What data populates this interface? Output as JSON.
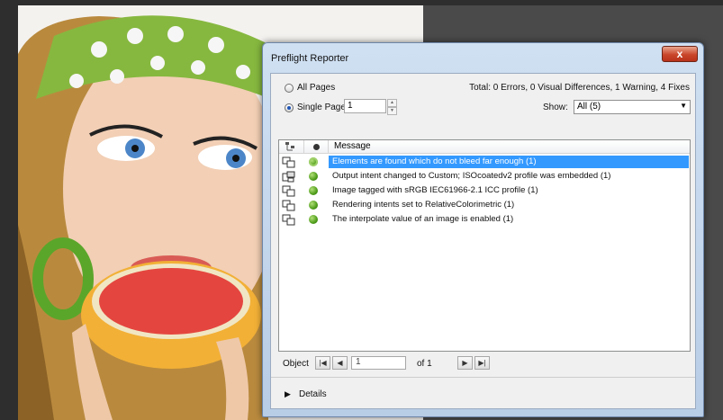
{
  "dialog": {
    "title": "Preflight Reporter",
    "close_glyph": "x",
    "pages": {
      "all_pages_label": "All Pages",
      "single_page_label": "Single Page",
      "single_page_value": "1",
      "selected": "single"
    },
    "summary": "Total: 0 Errors, 0 Visual Differences, 1 Warning, 4 Fixes",
    "show": {
      "label": "Show:",
      "value": "All (5)"
    },
    "list": {
      "message_header": "Message",
      "rows": [
        {
          "message": "Elements are found which do not bleed far enough (1)",
          "selected": true,
          "icon": "fix-object-icon"
        },
        {
          "message": "Output intent changed to Custom; ISOcoatedv2 profile was embedded (1)",
          "selected": false,
          "icon": "output-intent-icon"
        },
        {
          "message": "Image tagged with sRGB IEC61966-2.1 ICC profile (1)",
          "selected": false,
          "icon": "fix-object-icon"
        },
        {
          "message": "Rendering intents set to RelativeColorimetric (1)",
          "selected": false,
          "icon": "fix-object-icon"
        },
        {
          "message": "The interpolate value of an image is enabled (1)",
          "selected": false,
          "icon": "fix-object-icon"
        }
      ]
    },
    "object_nav": {
      "label": "Object",
      "value": "1",
      "of_label": "of 1"
    },
    "details_label": "Details",
    "colors": {
      "selection": "#3399ff",
      "status_green": "#4f9d1a",
      "close_red": "#c9472b"
    }
  }
}
